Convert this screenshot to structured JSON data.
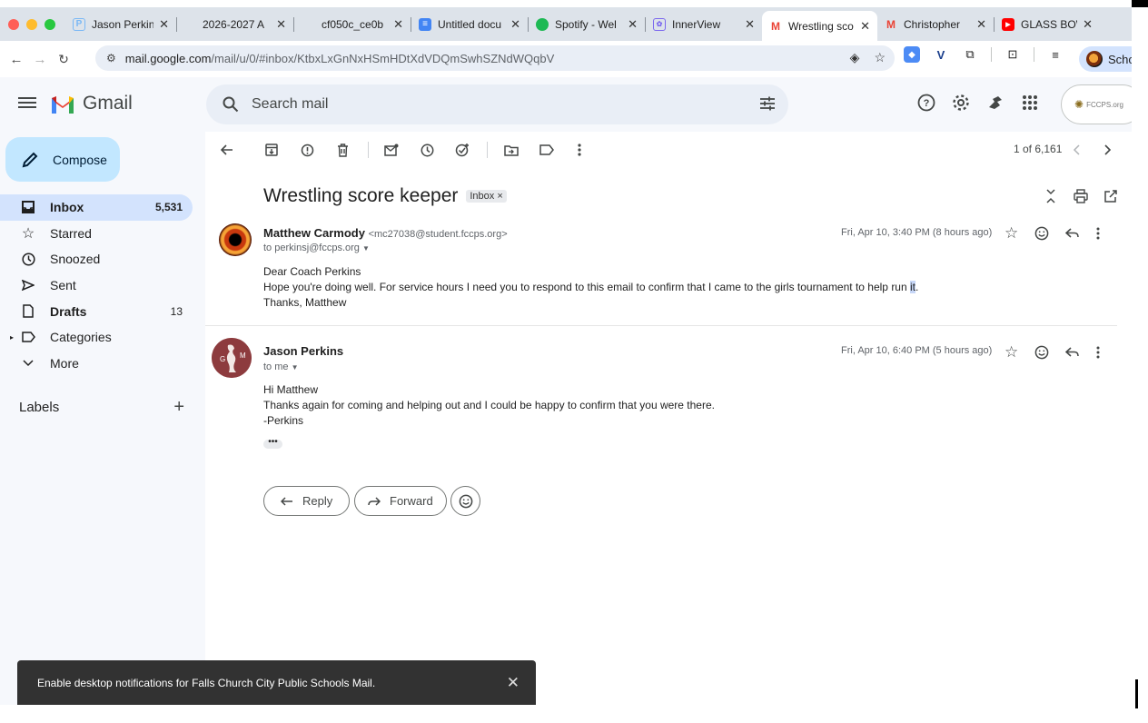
{
  "browser": {
    "tabs": [
      {
        "title": "Jason Perkin",
        "favicon": "P",
        "favicon_color": "#7ab8f5"
      },
      {
        "title": "2026-2027 A",
        "favicon": "",
        "favicon_color": ""
      },
      {
        "title": "cf050c_ce0b",
        "favicon": "",
        "favicon_color": ""
      },
      {
        "title": "Untitled docu",
        "favicon": "≡",
        "favicon_color": "#4285f4"
      },
      {
        "title": "Spotify - Wel",
        "favicon": "",
        "favicon_color": "#1db954"
      },
      {
        "title": "InnerView",
        "favicon": "",
        "favicon_color": "#7b68ee"
      },
      {
        "title": "Wrestling sco",
        "favicon": "M",
        "favicon_color": "#ea4335"
      },
      {
        "title": "Christopher",
        "favicon": "M",
        "favicon_color": "#ea4335"
      },
      {
        "title": "GLASS BOW",
        "favicon": "▶",
        "favicon_color": "#ff0000"
      }
    ],
    "active_tab_index": 6,
    "url_host": "mail.google.com",
    "url_path": "/mail/u/0/#inbox/KtbxLxGnNxHSmHDtXdVDQmSwhSZNdWQqbV",
    "profile_label": "Scho"
  },
  "header": {
    "app_name": "Gmail",
    "search_placeholder": "Search mail",
    "org_label": "FCCPS.org"
  },
  "sidebar": {
    "compose_label": "Compose",
    "items": [
      {
        "label": "Inbox",
        "count": "5,531",
        "icon": "inbox-icon"
      },
      {
        "label": "Starred",
        "count": "",
        "icon": "star-icon"
      },
      {
        "label": "Snoozed",
        "count": "",
        "icon": "clock-icon"
      },
      {
        "label": "Sent",
        "count": "",
        "icon": "send-icon"
      },
      {
        "label": "Drafts",
        "count": "13",
        "icon": "draft-icon"
      },
      {
        "label": "Categories",
        "count": "",
        "icon": "label-icon"
      },
      {
        "label": "More",
        "count": "",
        "icon": "chevron-down-icon"
      }
    ],
    "labels_heading": "Labels"
  },
  "thread": {
    "pager": "1 of 6,161",
    "subject": "Wrestling score keeper",
    "chip": "Inbox",
    "chip_close": "×",
    "messages": [
      {
        "sender": "Matthew Carmody",
        "email": "<mc27038@student.fccps.org>",
        "to": "to perkinsj@fccps.org",
        "date": "Fri, Apr 10, 3:40 PM (8 hours ago)",
        "body": [
          "Dear Coach Perkins",
          "Hope you're doing well. For service hours I need you to respond to this email to confirm that I came to the girls tournament to help run ",
          "Thanks, Matthew"
        ],
        "highlight": "it",
        "highlight_after": "."
      },
      {
        "sender": "Jason Perkins",
        "email": "",
        "to": "to me",
        "date": "Fri, Apr 10, 6:40 PM (5 hours ago)",
        "body": [
          "Hi Matthew",
          "Thanks again for coming and helping out and I could be happy to confirm that you were there.",
          "-Perkins"
        ]
      }
    ],
    "ellipsis": "•••",
    "reply_label": "Reply",
    "forward_label": "Forward"
  },
  "toast": {
    "message": "Enable desktop notifications for Falls Church City Public Schools Mail."
  }
}
